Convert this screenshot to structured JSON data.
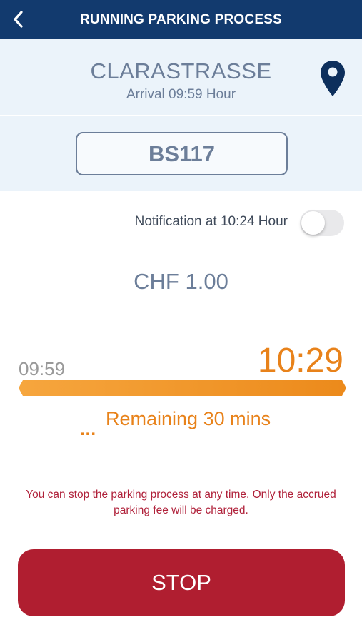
{
  "header": {
    "title": "RUNNING PARKING PROCESS",
    "back_icon": "chevron-left-icon",
    "background": "#123a6e"
  },
  "location": {
    "street": "CLARASTRASSE",
    "arrival": "Arrival 09:59 Hour",
    "pin_icon": "map-pin-icon",
    "pin_color": "#0d2f5c"
  },
  "vehicle": {
    "plate": "BS117"
  },
  "notification": {
    "label": "Notification at 10:24 Hour",
    "enabled": false
  },
  "fee": {
    "amount": "CHF 1.00"
  },
  "timeline": {
    "start": "09:59",
    "end": "10:29",
    "progress_fraction": 1.0,
    "accent_color": "#e8821a"
  },
  "remaining": {
    "dots": "...",
    "text": "Remaining 30 mins"
  },
  "info": {
    "text": "You can stop the parking process at any time. Only the accrued parking fee will be charged."
  },
  "actions": {
    "stop_label": "STOP",
    "stop_color": "#b01e30"
  }
}
